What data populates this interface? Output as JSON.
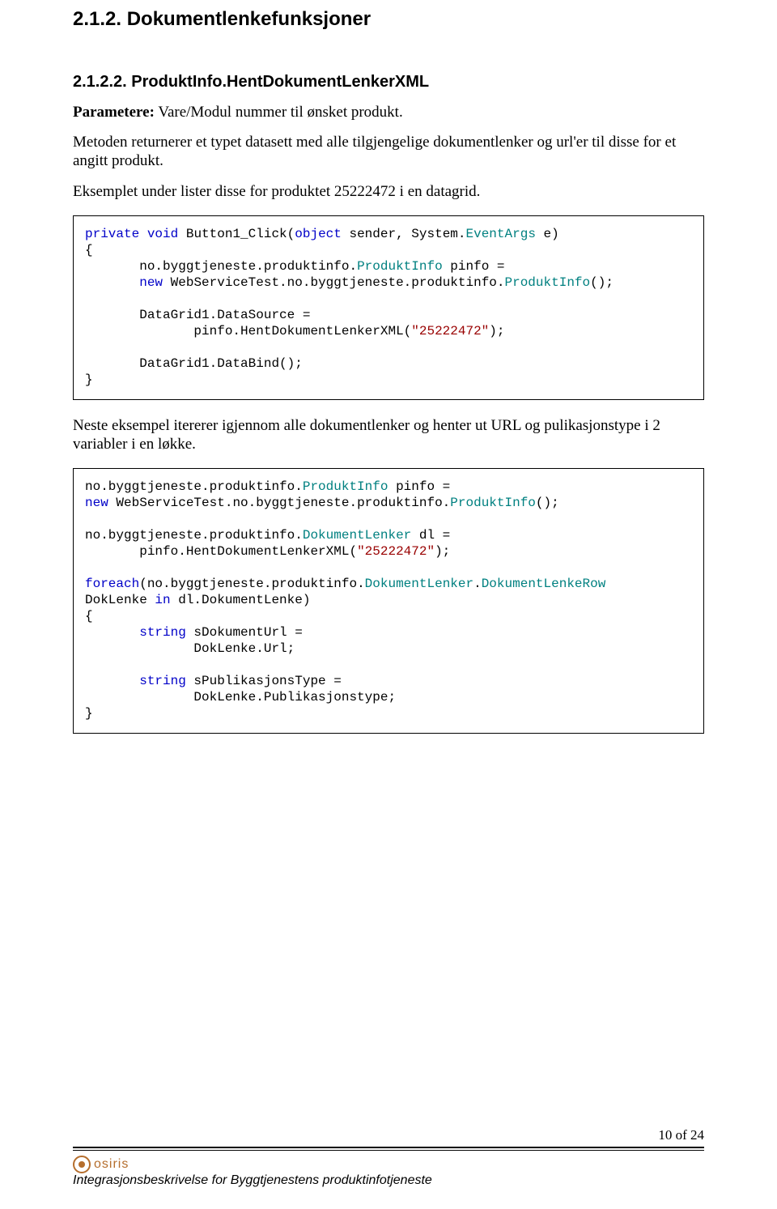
{
  "headings": {
    "h1": "2.1.2.  Dokumentlenkefunksjoner",
    "h2": "2.1.2.2.  ProduktInfo.HentDokumentLenkerXML"
  },
  "paragraphs": {
    "p1_label": "Parametere:",
    "p1_rest": " Vare/Modul nummer til ønsket produkt.",
    "p2": "Metoden returnerer et typet datasett med alle tilgjengelige dokumentlenker og url'er til disse for et angitt produkt.",
    "p3": "Eksemplet under lister disse for produktet 25222472 i en datagrid.",
    "p4": "Neste eksempel itererer igjennom alle dokumentlenker og henter ut URL og pulikasjonstype i 2 variabler i en løkke."
  },
  "code1": {
    "l1a": "private",
    "l1b": " ",
    "l1c": "void",
    "l1d": " Button1_Click(",
    "l1e": "object",
    "l1f": " sender, System.",
    "l1g": "EventArgs",
    "l1h": " e)",
    "l2": "{",
    "l3": "       no.byggtjeneste.produktinfo.",
    "l3b": "ProduktInfo",
    "l3c": " pinfo =",
    "l4a": "       ",
    "l4b": "new",
    "l4c": " WebServiceTest.no.byggtjeneste.produktinfo.",
    "l4d": "ProduktInfo",
    "l4e": "();",
    "blank": "",
    "l5": "       DataGrid1.DataSource =",
    "l6a": "              pinfo.HentDokumentLenkerXML(",
    "l6b": "\"25222472\"",
    "l6c": ");",
    "l7": "       DataGrid1.DataBind();",
    "l8": "}"
  },
  "code2": {
    "l1": "no.byggtjeneste.produktinfo.",
    "l1b": "ProduktInfo",
    "l1c": " pinfo =",
    "l2a": "new",
    "l2b": " WebServiceTest.no.byggtjeneste.produktinfo.",
    "l2c": "ProduktInfo",
    "l2d": "();",
    "l3": "no.byggtjeneste.produktinfo.",
    "l3b": "DokumentLenker",
    "l3c": " dl =",
    "l4a": "       pinfo.HentDokumentLenkerXML(",
    "l4b": "\"25222472\"",
    "l4c": ");",
    "l5a": "foreach",
    "l5b": "(no.byggtjeneste.produktinfo.",
    "l5c": "DokumentLenker",
    "l5d": ".",
    "l5e": "DokumentLenkeRow",
    "l6a": "DokLenke ",
    "l6b": "in",
    "l6c": " dl.DokumentLenke)",
    "l7": "{",
    "l8a": "       ",
    "l8b": "string",
    "l8c": " sDokumentUrl =",
    "l9": "              DokLenke.Url;",
    "l10a": "       ",
    "l10b": "string",
    "l10c": " sPublikasjonsType =",
    "l11": "              DokLenke.Publikasjonstype;",
    "l12": "}"
  },
  "footer": {
    "page": "10 of 24",
    "title": "Integrasjonsbeskrivelse for Byggtjenestens produktinfotjeneste",
    "logo": "osiris"
  }
}
